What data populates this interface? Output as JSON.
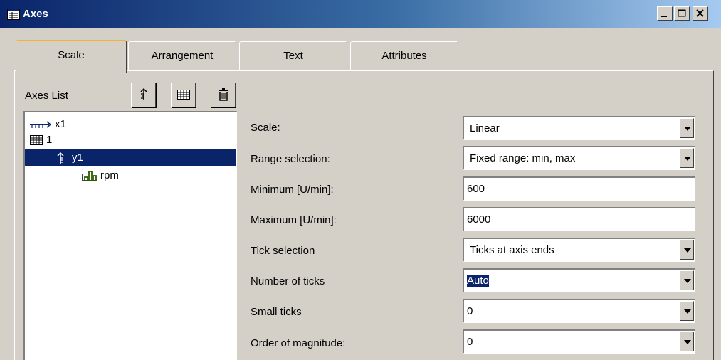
{
  "window": {
    "title": "Axes"
  },
  "tabs": [
    {
      "label": "Scale",
      "active": true
    },
    {
      "label": "Arrangement",
      "active": false
    },
    {
      "label": "Text",
      "active": false
    },
    {
      "label": "Attributes",
      "active": false
    }
  ],
  "axes_list": {
    "label": "Axes List",
    "toolbar_icons": [
      "axis-up-icon",
      "coordinate-system-icon",
      "trash-icon"
    ],
    "tree": [
      {
        "label": "x1",
        "icon": "x-axis-icon",
        "level": 0
      },
      {
        "label": "1",
        "icon": "coordinate-system-icon",
        "level": 0
      },
      {
        "label": "y1",
        "icon": "y-axis-icon",
        "level": 1,
        "selected": true
      },
      {
        "label": "rpm",
        "icon": "channel-icon",
        "level": 2
      }
    ]
  },
  "fields": {
    "scale": {
      "label": "Scale:",
      "value": "Linear",
      "type": "select"
    },
    "range_selection": {
      "label": "Range selection:",
      "value": "Fixed range: min, max",
      "type": "select"
    },
    "minimum": {
      "label": "Minimum [U/min]:",
      "value": "600",
      "type": "input"
    },
    "maximum": {
      "label": "Maximum [U/min]:",
      "value": "6000",
      "type": "input"
    },
    "tick_selection": {
      "label": "Tick selection",
      "value": "Ticks at axis ends",
      "type": "select"
    },
    "number_of_ticks": {
      "label": "Number of ticks",
      "value": "Auto",
      "type": "select",
      "text_selected": true
    },
    "small_ticks": {
      "label": "Small ticks",
      "value": "0",
      "type": "select"
    },
    "order_of_magnitude": {
      "label": "Order of magnitude:",
      "value": "0",
      "type": "select"
    }
  },
  "colors": {
    "title_gradient_start": "#0a246a",
    "title_gradient_end": "#a6caf0",
    "selection": "#0a246a",
    "face": "#d4d0c8",
    "active_tab_accent": "#f2b532"
  }
}
